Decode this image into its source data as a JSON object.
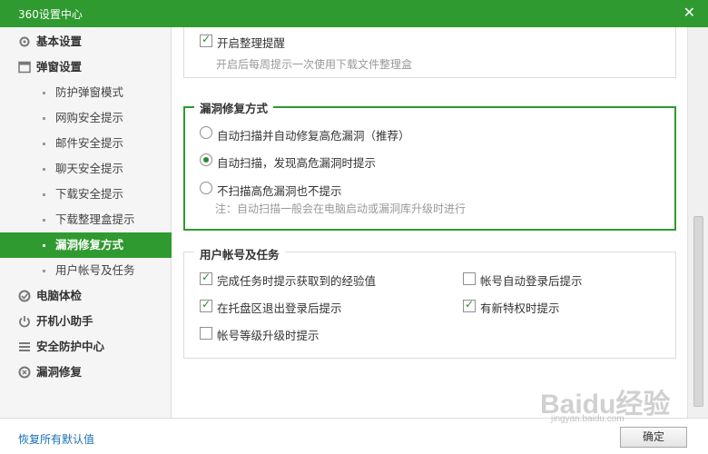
{
  "window": {
    "title": "360设置中心",
    "close_label": "✕"
  },
  "sidebar": {
    "items": [
      {
        "label": "基本设置",
        "icon": "gear-icon"
      },
      {
        "label": "弹窗设置",
        "icon": "window-icon"
      },
      {
        "label": "防护弹窗模式"
      },
      {
        "label": "网购安全提示"
      },
      {
        "label": "邮件安全提示"
      },
      {
        "label": "聊天安全提示"
      },
      {
        "label": "下载安全提示"
      },
      {
        "label": "下载整理盒提示"
      },
      {
        "label": "漏洞修复方式"
      },
      {
        "label": "用户帐号及任务"
      },
      {
        "label": "电脑体检",
        "icon": "checkup-icon"
      },
      {
        "label": "开机小助手",
        "icon": "power-icon"
      },
      {
        "label": "安全防护中心",
        "icon": "shield-grid-icon"
      },
      {
        "label": "漏洞修复",
        "icon": "repair-icon"
      }
    ]
  },
  "download_box": {
    "checkbox_label": "开启整理提醒",
    "checked": true,
    "note": "开启后每周提示一次使用下载文件整理盒"
  },
  "vuln_repair": {
    "legend": "漏洞修复方式",
    "options": [
      {
        "label": "自动扫描并自动修复高危漏洞（推荐）",
        "selected": false
      },
      {
        "label": "自动扫描，发现高危漏洞时提示",
        "selected": true
      },
      {
        "label": "不扫描高危漏洞也不提示",
        "selected": false
      }
    ],
    "note": "注：自动扫描一般会在电脑启动或漏洞库升级时进行"
  },
  "account_tasks": {
    "legend": "用户帐号及任务",
    "items": [
      {
        "label": "完成任务时提示获取到的经验值",
        "checked": true
      },
      {
        "label": "帐号自动登录后提示",
        "checked": false
      },
      {
        "label": "在托盘区退出登录后提示",
        "checked": true
      },
      {
        "label": "有新特权时提示",
        "checked": true
      },
      {
        "label": "帐号等级升级时提示",
        "checked": false
      }
    ]
  },
  "footer": {
    "restore_label": "恢复所有默认值",
    "ok_label": "确定",
    "watermark": "Baidu经验",
    "watermark_sub": "jingyan.baidu.com"
  },
  "colors": {
    "accent": "#2f9a2f",
    "link": "#1a6fb5"
  }
}
